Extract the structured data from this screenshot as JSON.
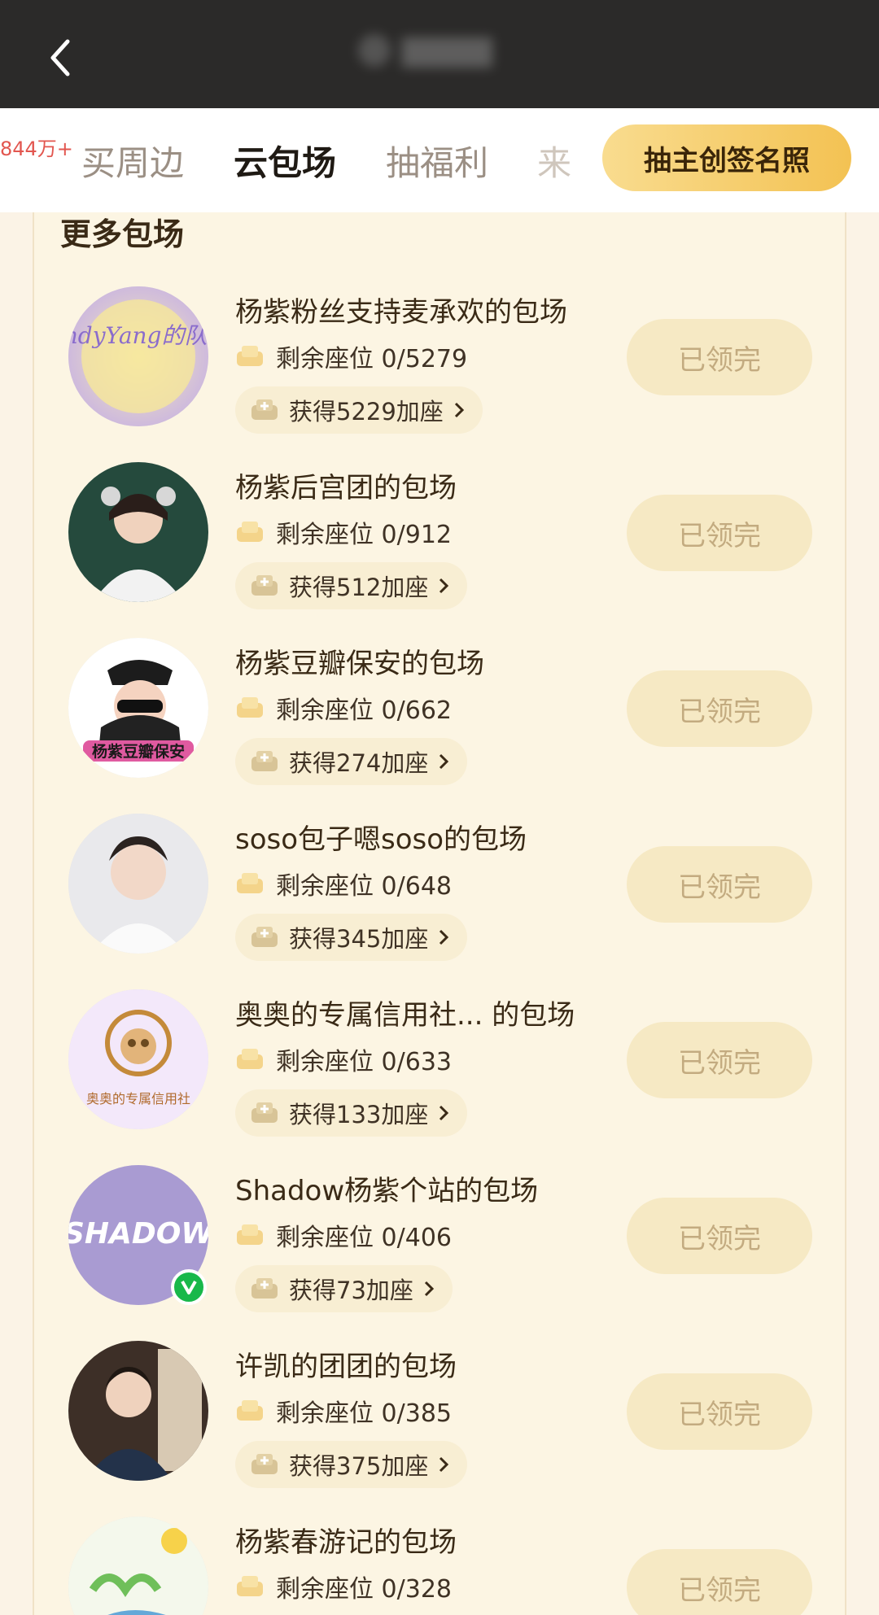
{
  "header": {
    "back_icon": "chevron-left-icon"
  },
  "tabs": {
    "count_badge": "844万+",
    "items": [
      "买周边",
      "云包场",
      "抽福利",
      "来"
    ],
    "active": "云包场",
    "cta_label": "抽主创签名照"
  },
  "section": {
    "title": "更多包场"
  },
  "rows": [
    {
      "title": "杨紫粉丝支持麦承欢的包场",
      "seats": "剩余座位 0/5279",
      "bonus": "获得5229加座",
      "status": "已领完",
      "avatar_text": "AndyYang的队队"
    },
    {
      "title": "杨紫后宫团的包场",
      "seats": "剩余座位 0/912",
      "bonus": "获得512加座",
      "status": "已领完"
    },
    {
      "title": "杨紫豆瓣保安的包场",
      "seats": "剩余座位 0/662",
      "bonus": "获得274加座",
      "status": "已领完",
      "avatar_text": "杨紫豆瓣保安"
    },
    {
      "title": "soso包子嗯soso的包场",
      "seats": "剩余座位 0/648",
      "bonus": "获得345加座",
      "status": "已领完"
    },
    {
      "title": "奥奥的专属信用社...  的包场",
      "seats": "剩余座位 0/633",
      "bonus": "获得133加座",
      "status": "已领完",
      "avatar_text": "奥奥的专属信用社"
    },
    {
      "title": "Shadow杨紫个站的包场",
      "seats": "剩余座位 0/406",
      "bonus": "获得73加座",
      "status": "已领完",
      "avatar_text": "SHADOW"
    },
    {
      "title": "许凯的团团的包场",
      "seats": "剩余座位 0/385",
      "bonus": "获得375加座",
      "status": "已领完"
    },
    {
      "title": "杨紫春游记的包场",
      "seats": "剩余座位 0/328",
      "bonus": "",
      "status": "已领完"
    }
  ],
  "colors": {
    "accent_gold": "#f3c253",
    "done_text": "#c3ab80",
    "badge_red": "#e2564f"
  }
}
